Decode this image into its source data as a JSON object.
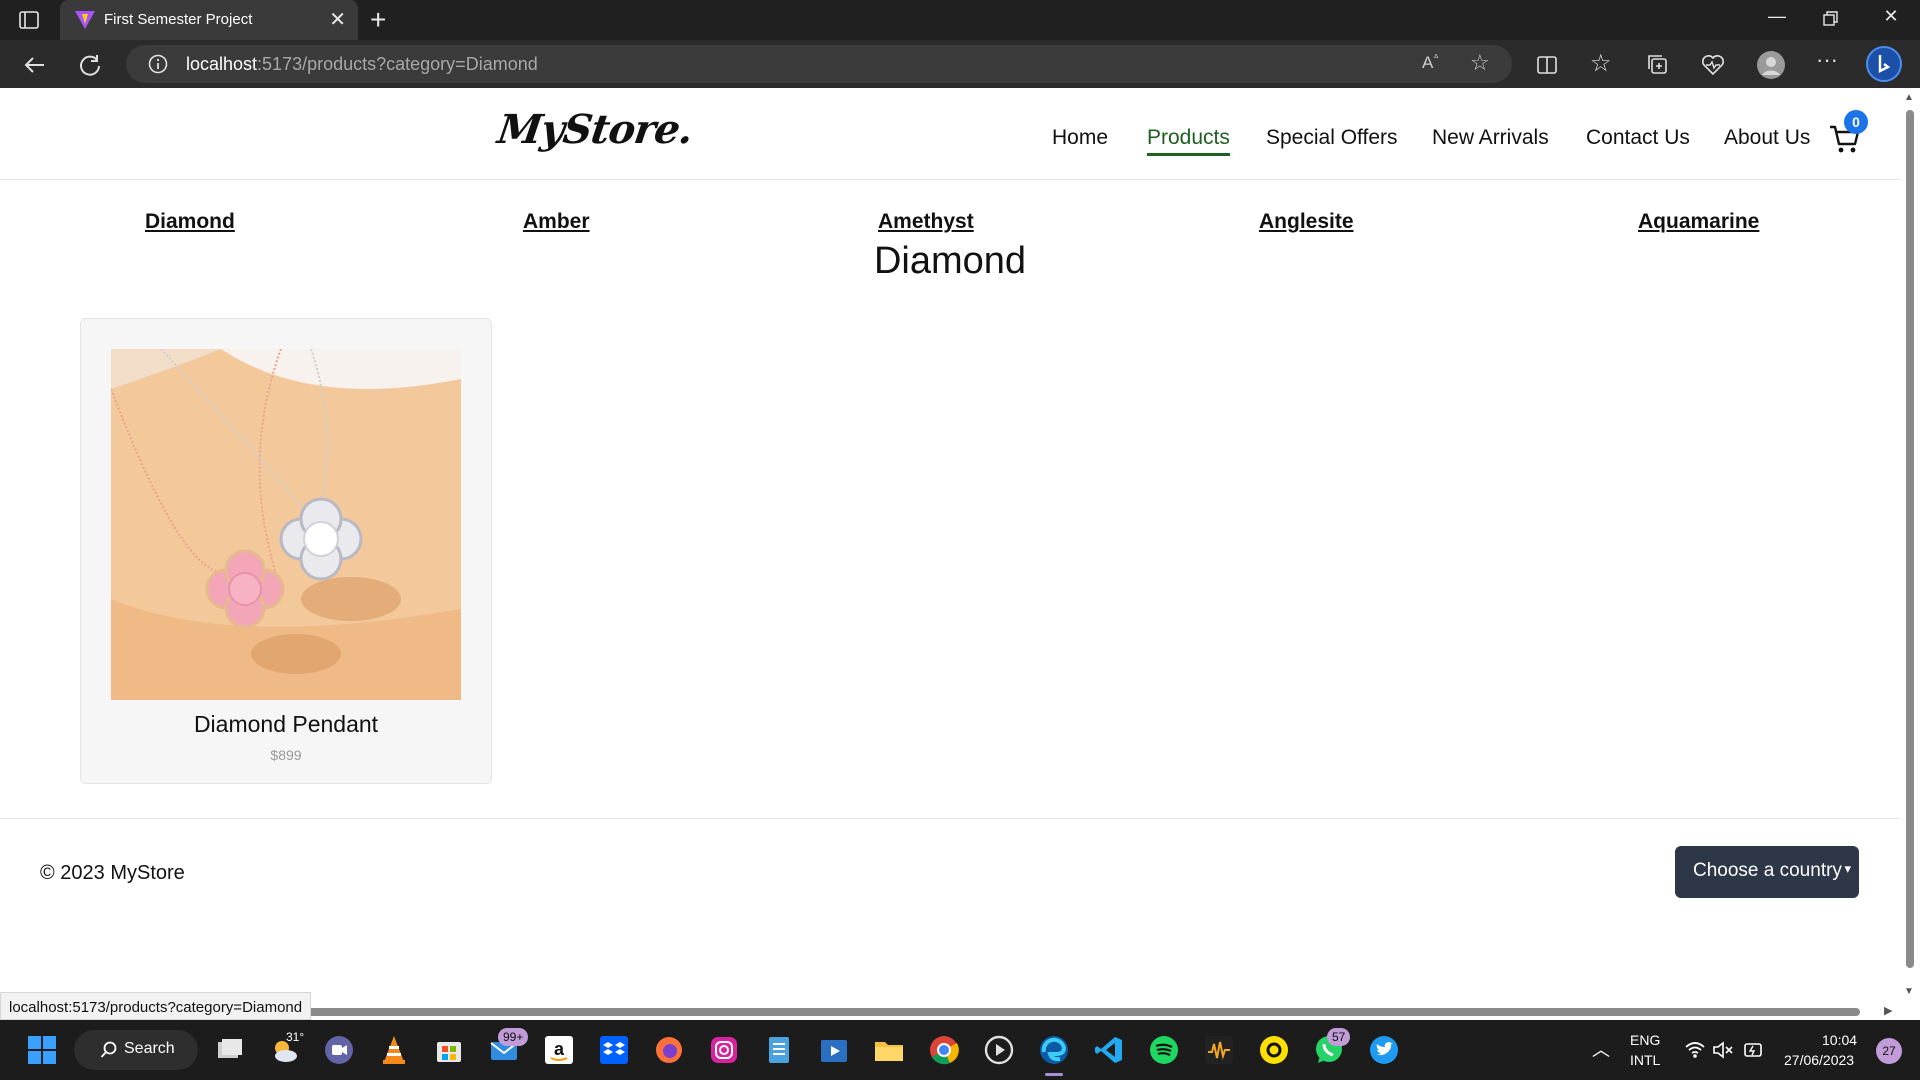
{
  "browser": {
    "tab_title": "First Semester Project",
    "tab_close": "✕",
    "new_tab": "+",
    "address_host": "localhost",
    "address_rest": ":5173/products?category=Diamond",
    "status_url": "localhost:5173/products?category=Diamond"
  },
  "header": {
    "logo": "MyStore.",
    "nav": [
      "Home",
      "Products",
      "Special Offers",
      "New Arrivals",
      "Contact Us",
      "About Us"
    ],
    "active_nav": "Products",
    "cart_count": "0"
  },
  "categories": [
    "Diamond",
    "Amber",
    "Amethyst",
    "Anglesite",
    "Aquamarine"
  ],
  "page_title": "Diamond",
  "products": [
    {
      "name": "Diamond Pendant",
      "price": "$899"
    }
  ],
  "footer": {
    "copyright": "© 2023 MyStore",
    "country_select": "Choose a country"
  },
  "taskbar": {
    "search_label": "Search",
    "weather": "31°",
    "mail_badge": "99+",
    "whatsapp_badge": "57",
    "lang_top": "ENG",
    "lang_bottom": "INTL",
    "time": "10:04",
    "date": "27/06/2023",
    "notifications": "27"
  },
  "colors": {
    "active_nav": "#1f5f1f",
    "cart_badge": "#1a73e8",
    "country_select_bg": "#2d3748"
  }
}
